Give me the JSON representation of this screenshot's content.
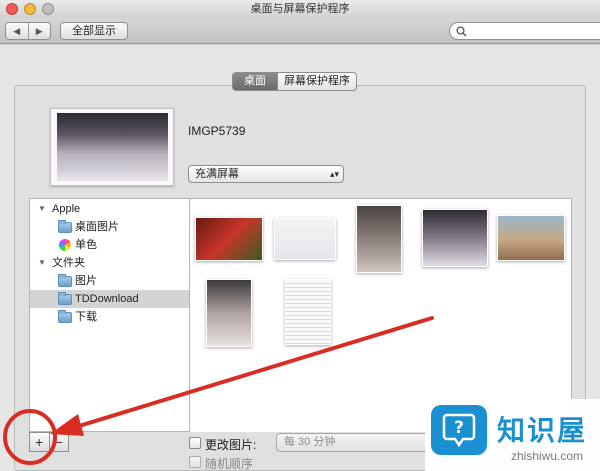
{
  "window": {
    "title": "桌面与屏幕保护程序"
  },
  "toolbar": {
    "back_icon": "◀",
    "forward_icon": "▶",
    "show_all_label": "全部显示",
    "search_placeholder": ""
  },
  "tabs": [
    {
      "label": "桌面",
      "active": true
    },
    {
      "label": "屏幕保护程序",
      "active": false
    }
  ],
  "current": {
    "filename": "IMGP5739",
    "fit_option": "充满屏幕"
  },
  "sidebar": {
    "groups": [
      {
        "label": "Apple",
        "items": [
          {
            "label": "桌面图片",
            "icon": "folder-icon"
          },
          {
            "label": "单色",
            "icon": "color-wheel-icon"
          }
        ]
      },
      {
        "label": "文件夹",
        "items": [
          {
            "label": "图片",
            "icon": "folder-icon"
          },
          {
            "label": "TDDownload",
            "icon": "folder-icon",
            "selected": true
          },
          {
            "label": "下载",
            "icon": "folder-icon"
          }
        ]
      }
    ]
  },
  "bottom": {
    "add_label": "+",
    "remove_label": "−",
    "change_picture_label": "更改图片:",
    "interval_label": "每 30 分钟",
    "random_order_label": "随机顺序"
  },
  "watermark": {
    "brand": "知识屋",
    "site": "zhishiwu.com"
  },
  "colors": {
    "accent": "#1a8fd2",
    "annotation": "#d92d23",
    "selection": "#d4d4d4"
  }
}
